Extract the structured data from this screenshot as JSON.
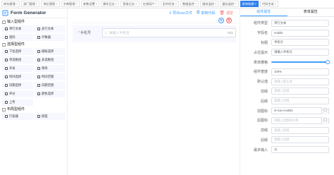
{
  "tabs": [
    {
      "label": "库存管理",
      "active": false
    },
    {
      "label": "部门管理",
      "active": false
    },
    {
      "label": "岗位管理",
      "active": false
    },
    {
      "label": "字典管理",
      "active": false
    },
    {
      "label": "参数设置",
      "active": false
    },
    {
      "label": "操作日志",
      "active": false
    },
    {
      "label": "登录日志",
      "active": false
    },
    {
      "label": "在线用户",
      "active": false
    },
    {
      "label": "定时任务",
      "active": false
    },
    {
      "label": "数据监控",
      "active": false
    },
    {
      "label": "服务监控",
      "active": false
    },
    {
      "label": "缓存监控",
      "active": false
    },
    {
      "label": "表单构建",
      "active": true
    },
    {
      "label": "代码生成",
      "active": false
    }
  ],
  "left": {
    "logo": "Form Generator",
    "groups": [
      {
        "title": "输入型组件",
        "icon": "input-group-icon",
        "items": [
          "单行文本",
          "多行文本",
          "密码",
          "计数器"
        ]
      },
      {
        "title": "选择型组件",
        "icon": "select-group-icon",
        "items": [
          "下拉选择",
          "级联选择",
          "单选框组",
          "多选框组",
          "开关",
          "滑块",
          "时间选择",
          "时间范围",
          "日期选择",
          "日期范围",
          "评分",
          "颜色选择",
          "上传"
        ]
      },
      {
        "title": "布局型组件",
        "icon": "layout-group-icon",
        "items": [
          "行容器",
          "按钮"
        ]
      }
    ]
  },
  "toolbar": {
    "export_label": "导出vue文件",
    "copy_label": "复制代码",
    "clear_label": "清空"
  },
  "canvas": {
    "field_label": "手机号",
    "field_placeholder": "请输入手机号",
    "field_count": "0/11"
  },
  "right": {
    "tab_component": "组件属性",
    "tab_form": "表单属性",
    "props": [
      {
        "label": "组件类型",
        "value": "单行文本",
        "placeholder": false,
        "kind": "select"
      },
      {
        "label": "字段名",
        "value": "mobile",
        "placeholder": false,
        "kind": "input"
      },
      {
        "label": "标题",
        "value": "手机号",
        "placeholder": false,
        "kind": "input"
      },
      {
        "label": "占位提示",
        "value": "请输入手机号",
        "placeholder": false,
        "kind": "input"
      },
      {
        "label": "表单栅格",
        "value": "",
        "placeholder": false,
        "kind": "slider",
        "level": 1.0
      },
      {
        "label": "组件宽度",
        "value": "100%",
        "placeholder": false,
        "kind": "input"
      },
      {
        "label": "默认值",
        "value": "请输入默认值",
        "placeholder": true,
        "kind": "input"
      },
      {
        "label": "前缀",
        "value": "请输入前缀",
        "placeholder": true,
        "kind": "input"
      },
      {
        "label": "后缀",
        "value": "请输入后缀",
        "placeholder": true,
        "kind": "input"
      },
      {
        "label": "前图标",
        "value": "el-icon-mobile",
        "placeholder": false,
        "kind": "icon"
      },
      {
        "label": "后图标",
        "value": "请输入后图标名称",
        "placeholder": true,
        "kind": "icon"
      },
      {
        "label": "前缀",
        "value": "请输入前缀",
        "placeholder": true,
        "kind": "input"
      },
      {
        "label": "后缀",
        "value": "请输入后缀",
        "placeholder": true,
        "kind": "input"
      },
      {
        "label": "最多输入",
        "value": "11",
        "placeholder": false,
        "kind": "input"
      }
    ]
  },
  "colors": {
    "accent": "#409eff",
    "danger": "#f56c6c",
    "tab_active": "#2f80ed",
    "tile_bg": "#f6f7ff"
  }
}
